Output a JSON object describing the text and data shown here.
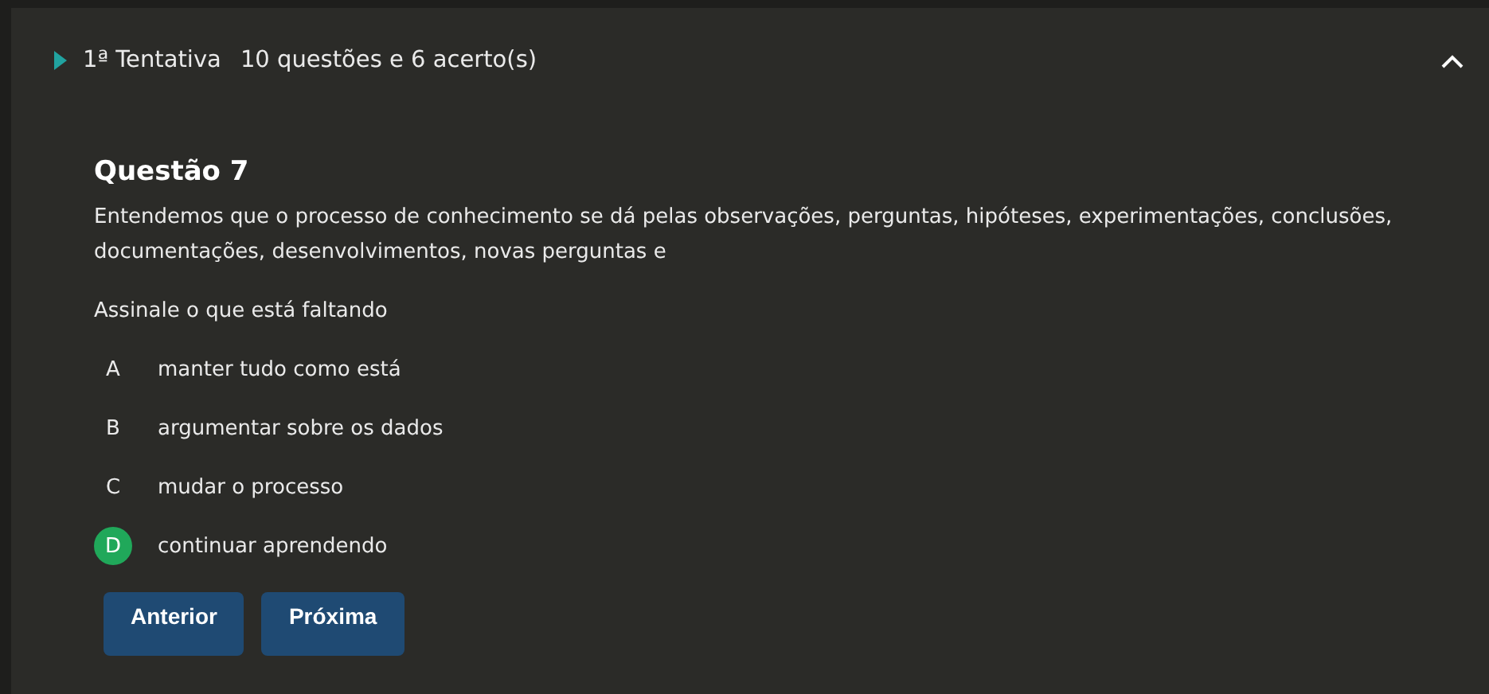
{
  "attempt": {
    "label": "1ª Tentativa",
    "summary": "10 questões e 6 acerto(s)",
    "expanded": true
  },
  "question": {
    "title": "Questão 7",
    "text": "Entendemos que o processo de conhecimento se dá pelas observações, perguntas, hipóteses, experimentações, conclusões, documentações, desenvolvimentos, novas perguntas e",
    "prompt": "Assinale o que está faltando",
    "options": [
      {
        "letter": "A",
        "text": "manter tudo como está",
        "selected": false
      },
      {
        "letter": "B",
        "text": "argumentar sobre os dados",
        "selected": false
      },
      {
        "letter": "C",
        "text": "mudar o processo",
        "selected": false
      },
      {
        "letter": "D",
        "text": "continuar aprendendo",
        "selected": true
      }
    ]
  },
  "buttons": [
    "Anterior",
    "Próxima"
  ]
}
